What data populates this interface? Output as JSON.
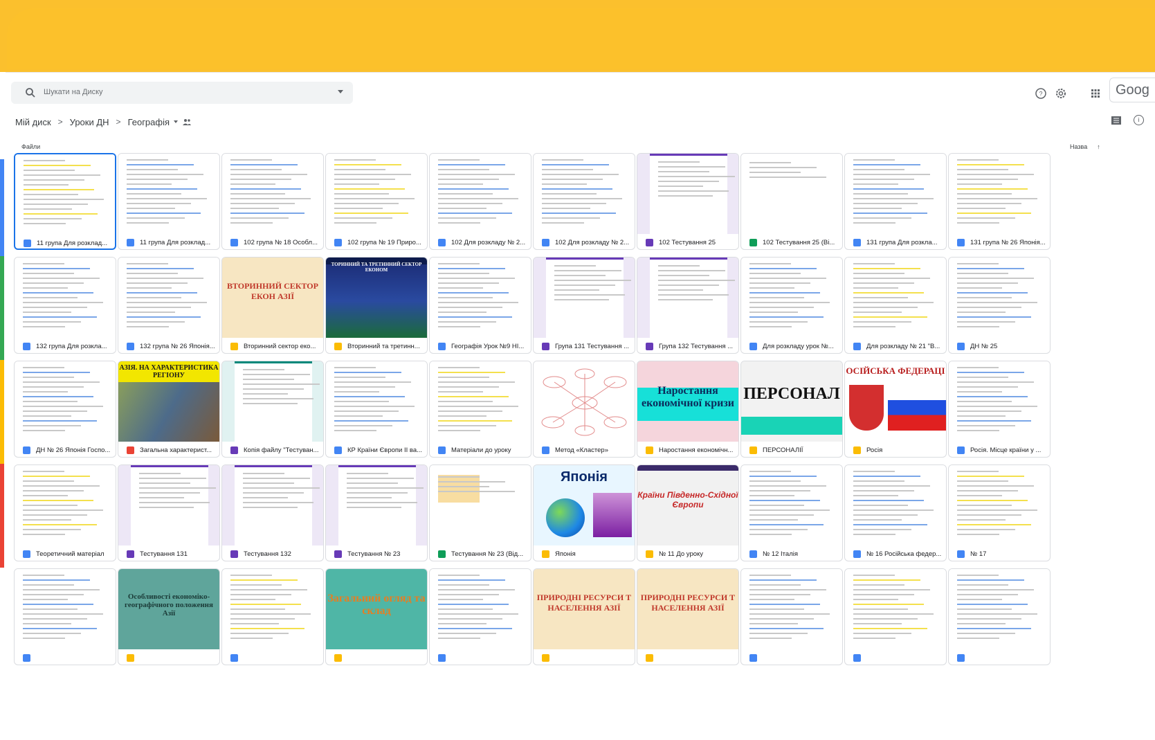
{
  "colors": {
    "banner": "#fbc02d",
    "accent": "#1a73e8",
    "doc_badge": "#4285f4",
    "form_badge": "#673ab7",
    "slides_badge": "#fbbc04",
    "sheets_badge": "#0f9d58",
    "pdf_badge": "#ea4335"
  },
  "header": {
    "search_placeholder": "Шукати на Диску",
    "google_text": "Goog"
  },
  "breadcrumb": {
    "items": [
      "Мій диск",
      "Уроки ДН",
      "Географія"
    ]
  },
  "section_label": "Файли",
  "sort_label": "Назва",
  "files": [
    {
      "name": "11 група Для розклад...",
      "type": "doc",
      "thumb": "doc"
    },
    {
      "name": "11 група Для розклад...",
      "type": "doc",
      "thumb": "doc"
    },
    {
      "name": "102 група № 18 Особл...",
      "type": "doc",
      "thumb": "doc"
    },
    {
      "name": "102 група № 19 Приро...",
      "type": "doc",
      "thumb": "doc"
    },
    {
      "name": "102 Для розкладу № 2...",
      "type": "doc",
      "thumb": "doc"
    },
    {
      "name": "102 Для розкладу № 2...",
      "type": "doc",
      "thumb": "doc"
    },
    {
      "name": "102 Тестування 25",
      "type": "form",
      "thumb": "form"
    },
    {
      "name": "102 Тестування 25 (Ві...",
      "type": "sheet",
      "thumb": "sheet"
    },
    {
      "name": "131 група Для розкла...",
      "type": "doc",
      "thumb": "doc"
    },
    {
      "name": "131 група № 26 Японія...",
      "type": "doc",
      "thumb": "doc"
    },
    {
      "name": "132 група Для розкла...",
      "type": "doc",
      "thumb": "doc"
    },
    {
      "name": "132 група № 26 Японія...",
      "type": "doc",
      "thumb": "doc"
    },
    {
      "name": "Вторинний сектор еко...",
      "type": "slides",
      "thumb": "slide-cream",
      "overlay": "ВТОРИННИЙ СЕКТОР ЕКОН АЗІЇ"
    },
    {
      "name": "Вторинний та третинн...",
      "type": "slides",
      "thumb": "slide-city",
      "overlay": "ТОРИННИЙ ТА ТРЕТИННИЙ СЕКТОР ЕКОНОМ"
    },
    {
      "name": "Географія Урок №9 НІ...",
      "type": "doc",
      "thumb": "doc"
    },
    {
      "name": "Група 131 Тестування ...",
      "type": "form",
      "thumb": "form"
    },
    {
      "name": "Група 132 Тестування ...",
      "type": "form",
      "thumb": "form"
    },
    {
      "name": "Для розкладу урок №...",
      "type": "doc",
      "thumb": "doc"
    },
    {
      "name": "Для розкладу № 21 \"В...",
      "type": "doc",
      "thumb": "doc"
    },
    {
      "name": "ДН № 25",
      "type": "doc",
      "thumb": "doc"
    },
    {
      "name": "ДН № 26 Японія Госпо...",
      "type": "doc",
      "thumb": "doc"
    },
    {
      "name": "Загальна характерист...",
      "type": "pdf",
      "thumb": "slide-photo",
      "overlay": "АЗІЯ. НА ХАРАКТЕРИСТИКА РЕГІОНУ"
    },
    {
      "name": "Копія файлу \"Тестуван...",
      "type": "form",
      "thumb": "form-teal"
    },
    {
      "name": "КР Країни Європи ІІ ва...",
      "type": "doc",
      "thumb": "doc"
    },
    {
      "name": "Матеріали до уроку",
      "type": "doc",
      "thumb": "doc"
    },
    {
      "name": "Метод «Кластер»",
      "type": "doc",
      "thumb": "cluster"
    },
    {
      "name": "Наростання економічн...",
      "type": "slides",
      "thumb": "slide-cyan",
      "overlay": "Наростання економічної кризи"
    },
    {
      "name": "ПЕРСОНАЛІЇ",
      "type": "slides",
      "thumb": "slide-persona",
      "overlay": "ПЕРСОНАЛ"
    },
    {
      "name": "Росія",
      "type": "slides",
      "thumb": "slide-russia",
      "overlay": "ОСІЙСЬКА ФЕДЕРАЦІ"
    },
    {
      "name": "Росія. Місце країни у ...",
      "type": "doc",
      "thumb": "doc"
    },
    {
      "name": "Теоретичний матеріал",
      "type": "doc",
      "thumb": "doc"
    },
    {
      "name": "Тестування 131",
      "type": "form",
      "thumb": "form"
    },
    {
      "name": "Тестування 132",
      "type": "form",
      "thumb": "form"
    },
    {
      "name": "Тестування № 23",
      "type": "form",
      "thumb": "form"
    },
    {
      "name": "Тестування № 23 (Від...",
      "type": "sheet",
      "thumb": "sheet-yellow"
    },
    {
      "name": "Японія",
      "type": "slides",
      "thumb": "slide-japan",
      "overlay": "Японія"
    },
    {
      "name": "№ 11 До уроку",
      "type": "slides",
      "thumb": "slide-europe",
      "overlay": "Країни Південно-Східної Європи"
    },
    {
      "name": "№ 12 Італія",
      "type": "doc",
      "thumb": "doc"
    },
    {
      "name": "№ 16 Російська федер...",
      "type": "doc",
      "thumb": "doc"
    },
    {
      "name": "№ 17",
      "type": "doc",
      "thumb": "doc"
    },
    {
      "name": "",
      "type": "doc",
      "thumb": "doc"
    },
    {
      "name": "",
      "type": "slides",
      "thumb": "slide-teal",
      "overlay": "Особливості економіко- географічного положення Азії"
    },
    {
      "name": "",
      "type": "doc",
      "thumb": "doc"
    },
    {
      "name": "",
      "type": "slides",
      "thumb": "slide-teal2",
      "overlay": "Загальний огляд та склад"
    },
    {
      "name": "",
      "type": "doc",
      "thumb": "doc"
    },
    {
      "name": "",
      "type": "slides",
      "thumb": "slide-cream",
      "overlay": "ПРИРОДНІ РЕСУРСИ Т НАСЕЛЕННЯ АЗІЇ"
    },
    {
      "name": "",
      "type": "slides",
      "thumb": "slide-cream",
      "overlay": "ПРИРОДНІ РЕСУРСИ Т НАСЕЛЕННЯ АЗІЇ"
    },
    {
      "name": "",
      "type": "doc",
      "thumb": "doc"
    },
    {
      "name": "",
      "type": "doc",
      "thumb": "doc"
    },
    {
      "name": "",
      "type": "doc",
      "thumb": "doc"
    }
  ]
}
